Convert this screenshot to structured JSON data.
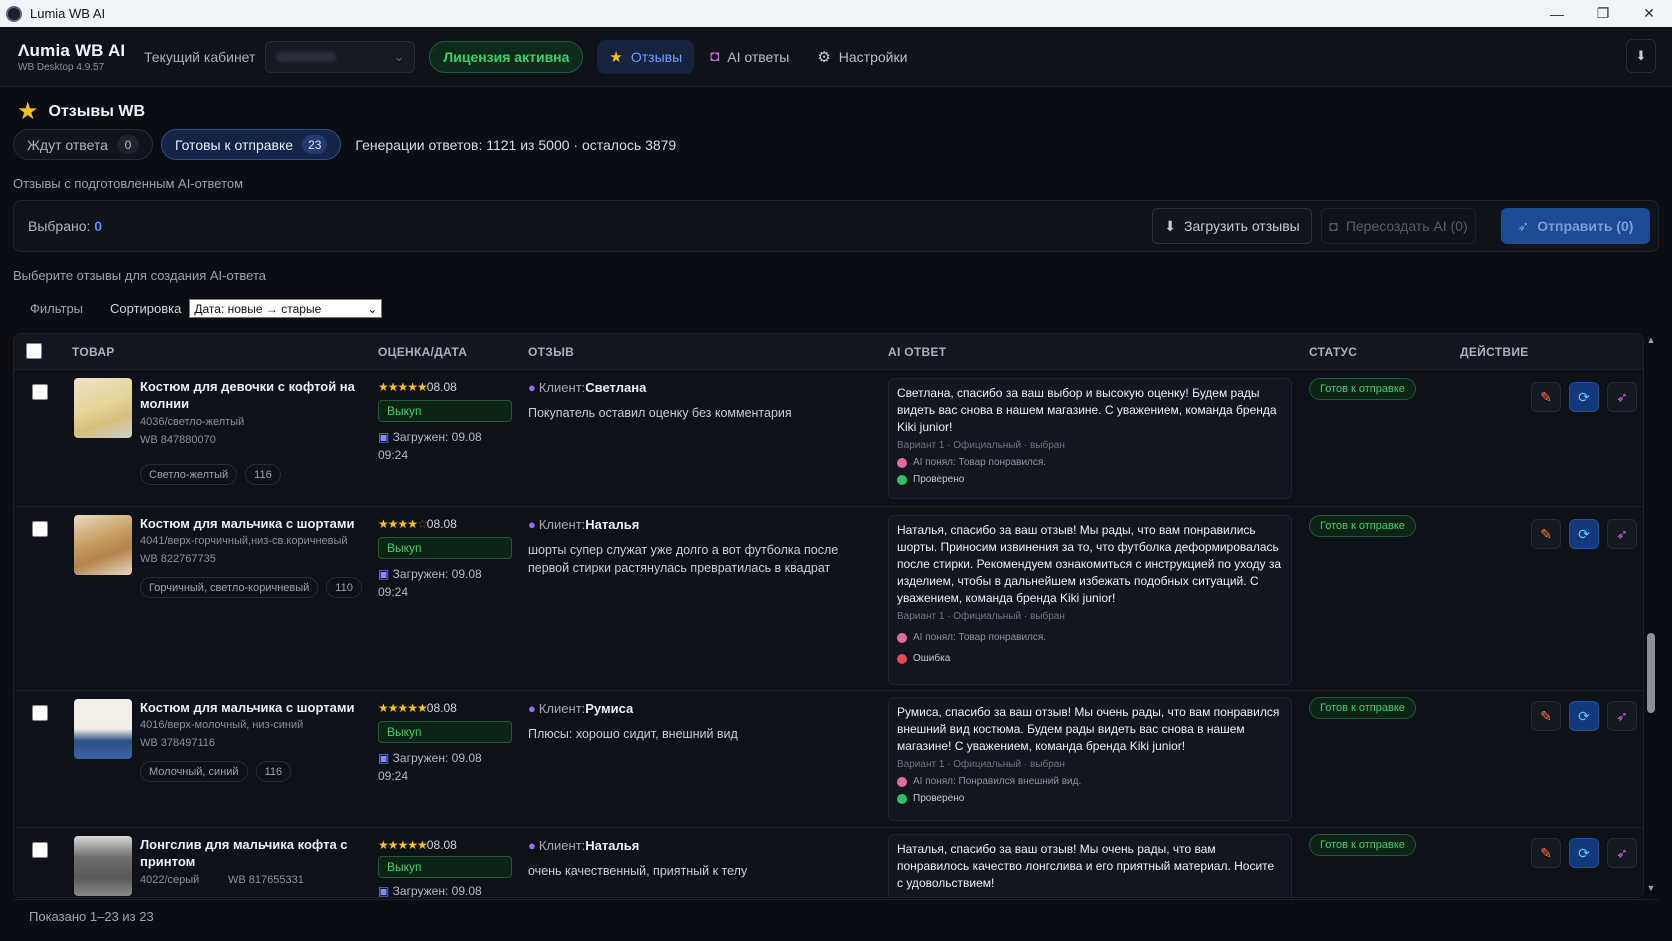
{
  "window": {
    "title": "Lumia WB AI",
    "minimize": "—",
    "maximize": "❐",
    "close": "✕"
  },
  "header": {
    "brand": "Λumia WB AI",
    "version": "WB Desktop 4.9.57",
    "cabinet_label": "Текущий кабинет",
    "license": "Лицензия активна",
    "tabs": [
      {
        "label": "Отзывы",
        "icon": "star-icon"
      },
      {
        "label": "AI ответы",
        "icon": "robot-icon"
      },
      {
        "label": "Настройки",
        "icon": "gear-icon"
      }
    ],
    "download_icon": "download-icon"
  },
  "page": {
    "title": "Отзывы WB",
    "status_tabs": [
      {
        "label": "Ждут ответа",
        "count": "0"
      },
      {
        "label": "Готовы к отправке",
        "count": "23"
      }
    ],
    "generations": "Генерации ответов: 1121 из 5000 · осталось 3879",
    "subhint": "Отзывы с подготовленным AI-ответом",
    "selected_label": "Выбрано:",
    "selected_count": "0",
    "buttons": {
      "load": "Загрузить отзывы",
      "regen": "Пересоздать AI (0)",
      "send": "Отправить (0)"
    },
    "hint2": "Выберите отзывы для создания AI-ответа",
    "filters_label": "Фильтры",
    "sort_label": "Сортировка",
    "sort_value": "Дата: новые → старые"
  },
  "table": {
    "columns": [
      "ТОВАР",
      "ОЦЕНКА/ДАТА",
      "ОТЗЫВ",
      "AI ОТВЕТ",
      "СТАТУС",
      "ДЕЙСТВИЕ"
    ],
    "rows": [
      {
        "name": "Костюм для девочки с кофтой на молнии",
        "article": "4036/светло-желтый",
        "wb": "WB 847880070",
        "color_tag": "Светло-желтый",
        "size_tag": "116",
        "rating": 5,
        "date": "08.08",
        "buyout": "Выкуп",
        "loaded": "Загружен: 09.08 09:24",
        "client_prefix": "Клиент:",
        "client": "Светлана",
        "review": "Покупатель оставил оценку без комментария",
        "ai_text": "Светлана, спасибо за ваш выбор и высокую оценку! Будем рады видеть вас снова в нашем магазине. С уважением, команда бренда Kiki junior!",
        "ai_meta": "Вариант 1 · Официальный · выбран",
        "ai_understood": "AI понял: Товар понравился.",
        "check_status": "Проверено",
        "check_color": "#2fbf61",
        "status": "Готов к отправке"
      },
      {
        "name": "Костюм для мальчика с шортами",
        "article": "4041/верх-горчичный,низ-св.коричневый",
        "wb": "WB 822767735",
        "color_tag": "Горчичный, светло-коричневый",
        "size_tag": "110",
        "rating": 4,
        "date": "08.08",
        "buyout": "Выкуп",
        "loaded": "Загружен: 09.08 09:24",
        "client_prefix": "Клиент:",
        "client": "Наталья",
        "review": "шорты супер служат уже долго а вот футболка после первой стирки растянулась превратилась в квадрат",
        "ai_text": "Наталья, спасибо за ваш отзыв! Мы рады, что вам понравились шорты. Приносим извинения за то, что футболка деформировалась после стирки. Рекомендуем ознакомиться с инструкцией по уходу за изделием, чтобы в дальнейшем избежать подобных ситуаций. С уважением, команда бренда Kiki junior!",
        "ai_meta": "Вариант 1 · Официальный · выбран",
        "ai_understood": "AI понял: Товар понравился.",
        "check_status": "Ошибка",
        "check_color": "#e5484d",
        "status": "Готов к отправке"
      },
      {
        "name": "Костюм для мальчика с шортами",
        "article": "4016/верх-молочный, низ-синий",
        "wb": "WB 378497116",
        "color_tag": "Молочный, синий",
        "size_tag": "116",
        "rating": 5,
        "date": "08.08",
        "buyout": "Выкуп",
        "loaded": "Загружен: 09.08 09:24",
        "client_prefix": "Клиент:",
        "client": "Румиса",
        "review": "Плюсы: хорошо сидит, внешний вид",
        "ai_text": "Румиса, спасибо за ваш отзыв! Мы очень рады, что вам понравился внешний вид костюма. Будем рады видеть вас снова в нашем магазине! С уважением, команда бренда Kiki junior!",
        "ai_meta": "Вариант 1 · Официальный · выбран",
        "ai_understood": "AI понял: Понравился внешний вид.",
        "check_status": "Проверено",
        "check_color": "#2fbf61",
        "status": "Готов к отправке"
      },
      {
        "name": "Лонгслив для мальчика кофта с принтом",
        "article": "4022/серый",
        "wb": "WB 817655331",
        "rating": 5,
        "date": "08.08",
        "buyout": "Выкуп",
        "loaded": "Загружен: 09.08",
        "client_prefix": "Клиент:",
        "client": "Наталья",
        "review": "очень качественный, приятный к телу",
        "ai_text": "Наталья, спасибо за ваш отзыв! Мы очень рады, что вам понравилось качество лонгслива и его приятный материал. Носите с удовольствием!",
        "status": "Готов к отправке"
      }
    ]
  },
  "footer": {
    "shown": "Показано 1–23 из 23"
  }
}
